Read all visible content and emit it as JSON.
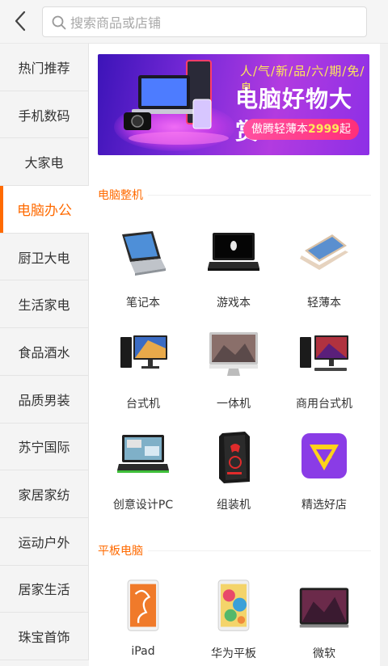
{
  "header": {
    "search_placeholder": "搜索商品或店铺"
  },
  "sidebar": {
    "items": [
      {
        "label": "热门推荐"
      },
      {
        "label": "手机数码"
      },
      {
        "label": "大家电"
      },
      {
        "label": "电脑办公"
      },
      {
        "label": "厨卫大电"
      },
      {
        "label": "生活家电"
      },
      {
        "label": "食品酒水"
      },
      {
        "label": "品质男装"
      },
      {
        "label": "苏宁国际"
      },
      {
        "label": "家居家纺"
      },
      {
        "label": "运动户外"
      },
      {
        "label": "居家生活"
      },
      {
        "label": "珠宝首饰"
      }
    ],
    "active_index": 3
  },
  "banner": {
    "line1": "人/气/新/品/六/期/免/息",
    "line2": "电脑好物大赏",
    "pill_prefix": "傲腾轻薄本",
    "pill_price": "2999",
    "pill_suffix": "起"
  },
  "sections": [
    {
      "title": "电脑整机",
      "items": [
        {
          "label": "笔记本",
          "icon": "laptop-convertible-icon"
        },
        {
          "label": "游戏本",
          "icon": "gaming-laptop-icon"
        },
        {
          "label": "轻薄本",
          "icon": "ultrabook-icon"
        },
        {
          "label": "台式机",
          "icon": "desktop-pc-icon"
        },
        {
          "label": "一体机",
          "icon": "all-in-one-icon"
        },
        {
          "label": "商用台式机",
          "icon": "business-desktop-icon"
        },
        {
          "label": "创意设计PC",
          "icon": "creative-laptop-icon"
        },
        {
          "label": "组装机",
          "icon": "custom-pc-case-icon"
        },
        {
          "label": "精选好店",
          "icon": "featured-store-icon"
        }
      ]
    },
    {
      "title": "平板电脑",
      "items": [
        {
          "label": "iPad",
          "icon": "ipad-icon"
        },
        {
          "label": "华为平板",
          "icon": "huawei-tablet-icon"
        },
        {
          "label": "微软",
          "icon": "microsoft-surface-icon"
        }
      ]
    }
  ],
  "colors": {
    "accent": "#ff6a00",
    "store_icon": "#8a3ce6",
    "store_icon_inner": "#ffd21a"
  }
}
